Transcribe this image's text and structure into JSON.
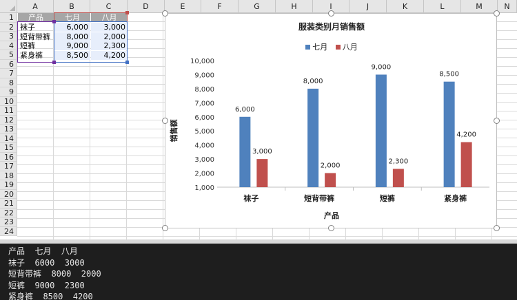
{
  "sheet": {
    "columns": [
      "A",
      "B",
      "C",
      "D",
      "E",
      "F",
      "G",
      "H",
      "I",
      "J",
      "K",
      "L",
      "M",
      "N"
    ],
    "rows": [
      "1",
      "2",
      "3",
      "4",
      "5",
      "6",
      "7",
      "8",
      "9",
      "10",
      "11",
      "12",
      "13",
      "14",
      "15",
      "16",
      "17",
      "18",
      "19",
      "20",
      "21",
      "22",
      "23",
      "24"
    ],
    "table": {
      "headers": [
        "产品",
        "七月",
        "八月"
      ],
      "rows": [
        [
          "袜子",
          "6,000",
          "3,000"
        ],
        [
          "短背带裤",
          "8,000",
          "2,000"
        ],
        [
          "短裤",
          "9,000",
          "2,300"
        ],
        [
          "紧身裤",
          "8,500",
          "4,200"
        ]
      ]
    }
  },
  "chart_data": {
    "type": "bar",
    "title": "服装类别月销售额",
    "xlabel": "产品",
    "ylabel": "销售额",
    "categories": [
      "袜子",
      "短背带裤",
      "短裤",
      "紧身裤"
    ],
    "series": [
      {
        "name": "七月",
        "values": [
          6000,
          8000,
          9000,
          8500
        ],
        "color": "#4f81bd"
      },
      {
        "name": "八月",
        "values": [
          3000,
          2000,
          2300,
          4200
        ],
        "color": "#c0504d"
      }
    ],
    "ylim": [
      1000,
      10000
    ],
    "yticks": [
      "1,000",
      "2,000",
      "3,000",
      "4,000",
      "5,000",
      "6,000",
      "7,000",
      "8,000",
      "9,000",
      "10,000"
    ],
    "data_labels": [
      [
        "6,000",
        "8,000",
        "9,000",
        "8,500"
      ],
      [
        "3,000",
        "2,000",
        "2,300",
        "4,200"
      ]
    ],
    "legend_position": "top",
    "grid": false
  },
  "terminal": {
    "lines": [
      "产品  七月  八月",
      "袜子  6000  3000",
      "短背带裤  8000  2000",
      "短裤  9000  2300",
      "紧身裤  8500  4200"
    ]
  }
}
